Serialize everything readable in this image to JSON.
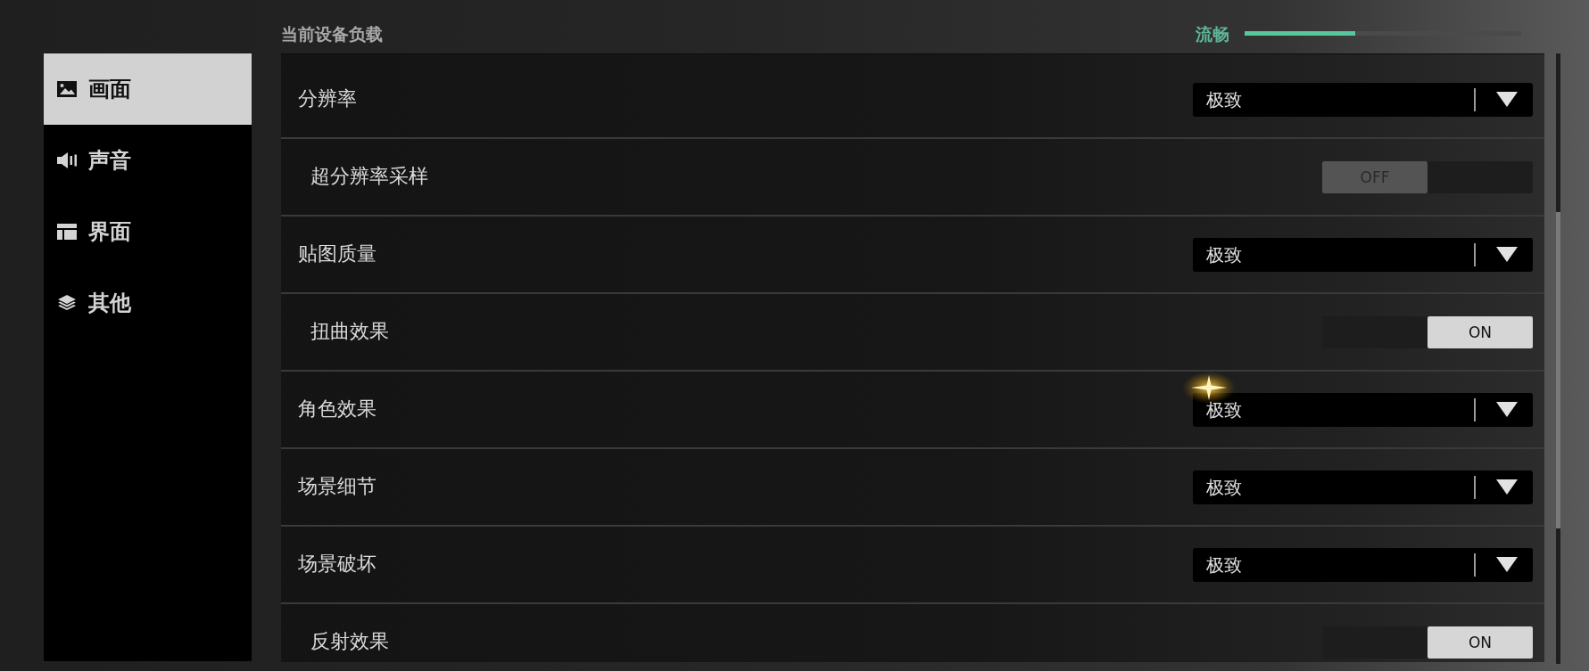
{
  "sidebar": {
    "items": [
      {
        "label": "画面",
        "selected": true
      },
      {
        "label": "声音",
        "selected": false
      },
      {
        "label": "界面",
        "selected": false
      },
      {
        "label": "其他",
        "selected": false
      }
    ]
  },
  "header": {
    "title": "当前设备负载"
  },
  "load": {
    "label": "流畅",
    "level": 0.4
  },
  "rows": [
    {
      "kind": "dropdown",
      "label": "分辨率",
      "value": "极致",
      "tapped": false
    },
    {
      "kind": "toggle",
      "label": "超分辨率采样",
      "on": false,
      "state_label": "OFF",
      "tapped": false
    },
    {
      "kind": "dropdown",
      "label": "贴图质量",
      "value": "极致",
      "tapped": false
    },
    {
      "kind": "toggle",
      "label": "扭曲效果",
      "on": true,
      "state_label": "ON",
      "tapped": false
    },
    {
      "kind": "dropdown",
      "label": "角色效果",
      "value": "极致",
      "tapped": true
    },
    {
      "kind": "dropdown",
      "label": "场景细节",
      "value": "极致",
      "tapped": false
    },
    {
      "kind": "dropdown",
      "label": "场景破坏",
      "value": "极致",
      "tapped": false
    },
    {
      "kind": "toggle",
      "label": "反射效果",
      "on": true,
      "state_label": "ON",
      "tapped": false
    }
  ]
}
